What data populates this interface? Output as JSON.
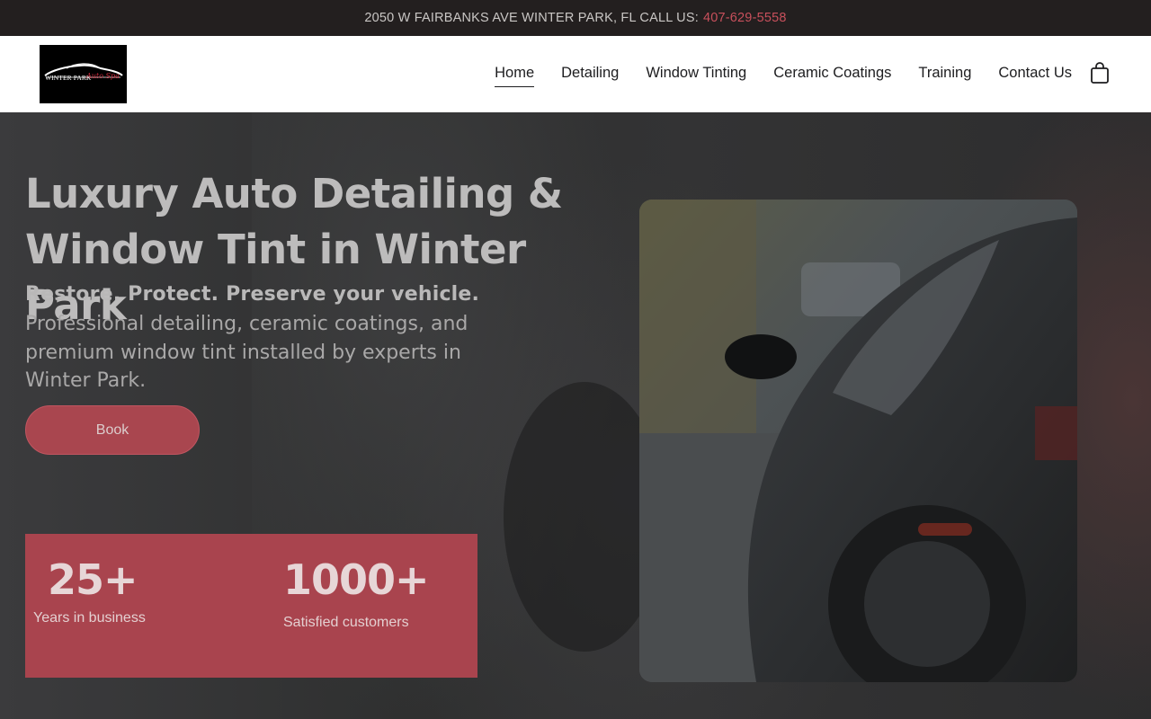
{
  "topbar": {
    "address": "2050 W FAIRBANKS AVE WINTER PARK, FL CALL US:",
    "phone": "407-629-5558"
  },
  "header": {
    "logo": {
      "text": "WINTER PARK",
      "script": "Auto Spa"
    },
    "nav": [
      {
        "label": "Home",
        "active": true
      },
      {
        "label": "Detailing",
        "active": false
      },
      {
        "label": "Window Tinting",
        "active": false
      },
      {
        "label": "Ceramic Coatings",
        "active": false
      },
      {
        "label": "Training",
        "active": false
      },
      {
        "label": "Contact Us",
        "active": false
      }
    ],
    "cart_icon": "shopping-bag-icon"
  },
  "hero": {
    "title_line1": "Luxury Auto Detailing &",
    "title_line2": "Window Tint in Winter Park",
    "subtitle_strong": "Restore. Protect. Preserve your vehicle.",
    "subtitle": "Professional detailing, ceramic coatings, and premium window tint installed by experts in Winter Park.",
    "book_label": "Book",
    "stats": [
      {
        "number": "25+",
        "label": "Years in business"
      },
      {
        "number": "1000+",
        "label": "Satisfied customers"
      }
    ],
    "image": "wet-dark-sports-car-photo"
  },
  "colors": {
    "accent": "#a9444e",
    "phone": "#c8505c",
    "topbar_bg": "#231f1f",
    "header_bg": "#ffffff"
  }
}
